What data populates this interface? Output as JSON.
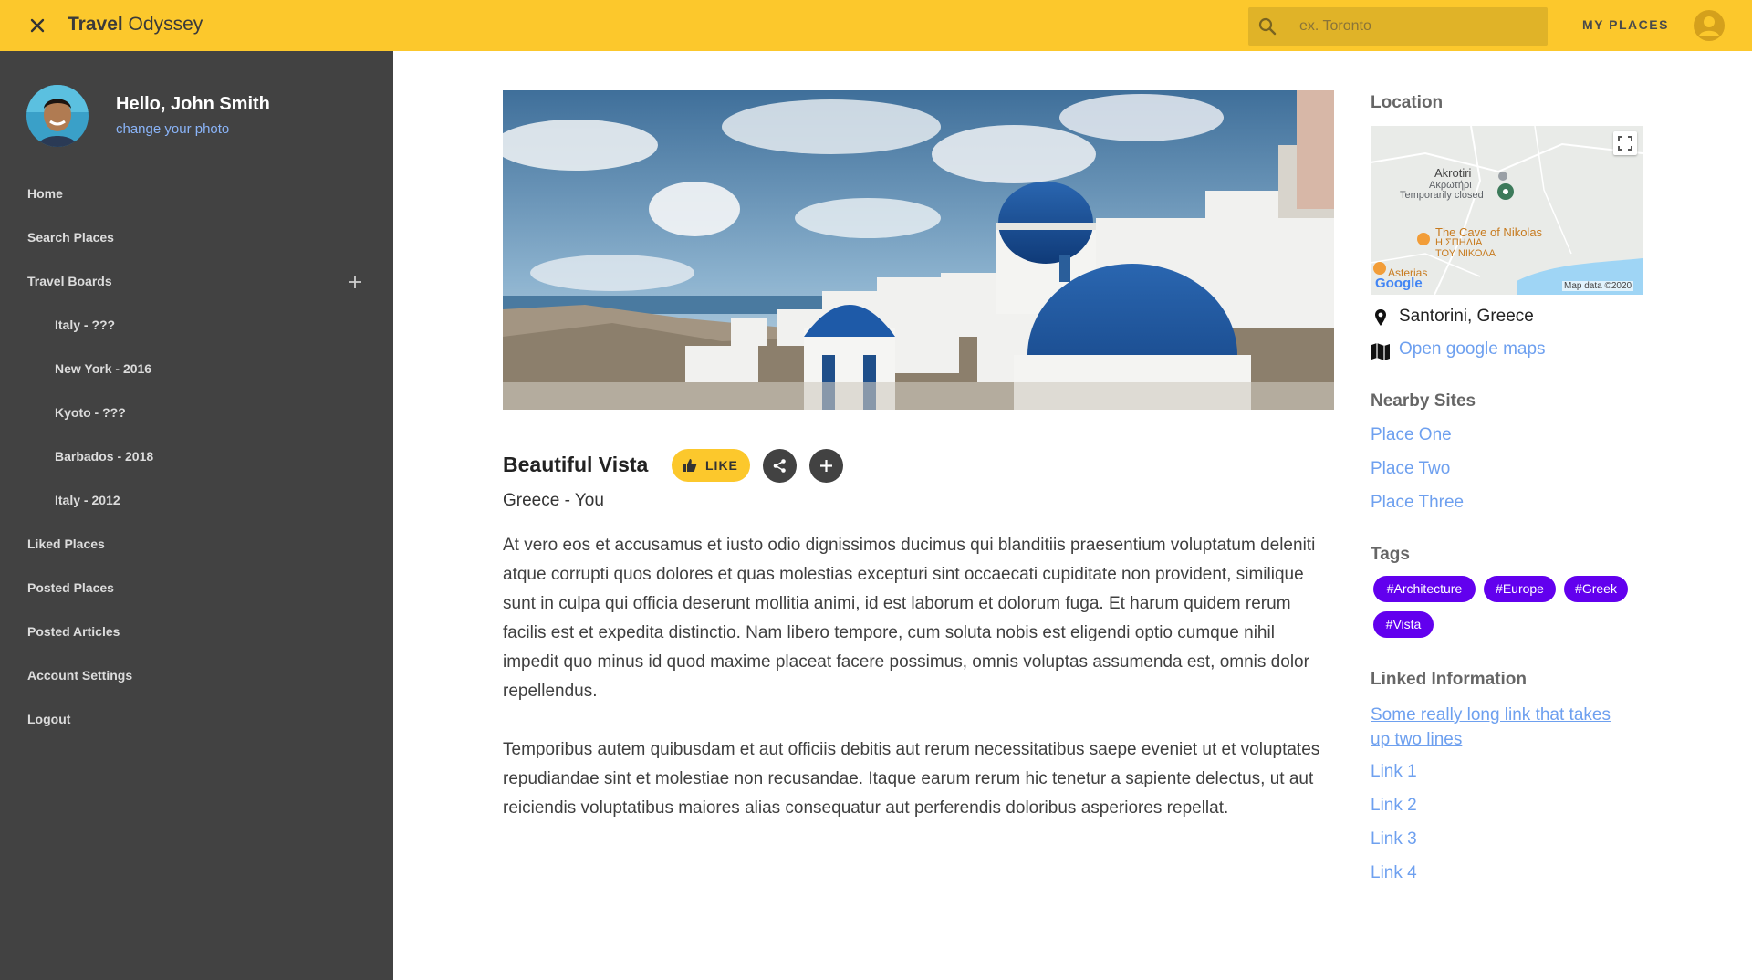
{
  "app": {
    "title_bold": "Travel",
    "title_rest": " Odyssey"
  },
  "search": {
    "placeholder": "ex. Toronto",
    "value": ""
  },
  "header": {
    "my_places": "MY PLACES"
  },
  "sidebar": {
    "greeting": "Hello, John Smith",
    "change_photo": "change your photo",
    "items": [
      {
        "label": "Home"
      },
      {
        "label": "Search Places"
      },
      {
        "label": "Travel Boards"
      },
      {
        "label": "Italy - ???"
      },
      {
        "label": "New York - 2016"
      },
      {
        "label": "Kyoto - ???"
      },
      {
        "label": "Barbados - 2018"
      },
      {
        "label": "Italy - 2012"
      },
      {
        "label": "Liked Places"
      },
      {
        "label": "Posted Places"
      },
      {
        "label": "Posted Articles"
      },
      {
        "label": "Account Settings"
      },
      {
        "label": "Logout"
      }
    ]
  },
  "place": {
    "title": "Beautiful Vista",
    "like_label": "LIKE",
    "subtitle": "Greece - You",
    "paragraphs": [
      "At vero eos et accusamus et iusto odio dignissimos ducimus qui blanditiis praesentium voluptatum deleniti atque corrupti quos dolores et quas molestias excepturi sint occaecati cupiditate non provident, similique sunt in culpa qui officia deserunt mollitia animi, id est laborum et dolorum fuga. Et harum quidem rerum facilis est et expedita distinctio. Nam libero tempore, cum soluta nobis est eligendi optio cumque nihil impedit quo minus id quod maxime placeat facere possimus, omnis voluptas assumenda est, omnis dolor repellendus.",
      "Temporibus autem quibusdam et aut officiis debitis aut rerum necessitatibus saepe eveniet ut et voluptates repudiandae sint et molestiae non recusandae. Itaque earum rerum hic tenetur a sapiente delectus, ut aut reiciendis voluptatibus maiores alias consequatur aut perferendis doloribus asperiores repellat."
    ]
  },
  "location": {
    "heading": "Location",
    "map_labels": {
      "akrotiri": "Akrotiri",
      "akrotiri_greek": "Ακρωτήρι",
      "temp_closed": "Temporarily closed",
      "cave": "The Cave of Nikolas",
      "cave_greek_1": "Η ΣΠΗΛΙΑ",
      "cave_greek_2": "ΤΟΥ ΝΙΚΟΛΑ",
      "asterias": "Asterias",
      "google": "Google",
      "map_data": "Map data ©2020"
    },
    "place": "Santorini, Greece",
    "open_maps": "Open google maps"
  },
  "nearby": {
    "heading": "Nearby Sites",
    "items": [
      "Place One",
      "Place Two",
      "Place Three"
    ]
  },
  "tags": {
    "heading": "Tags",
    "items": [
      "#Architecture",
      "#Europe",
      "#Greek",
      "#Vista"
    ]
  },
  "linked": {
    "heading": "Linked Information",
    "long_link_line1": "Some really long link that takes",
    "long_link_line2": "up two lines",
    "items": [
      "Link 1",
      "Link 2",
      "Link 3",
      "Link 4"
    ]
  },
  "colors": {
    "accent": "#fcc82c",
    "sidebar": "#424242",
    "tag": "#6200ee",
    "link": "#6ea0ef"
  }
}
